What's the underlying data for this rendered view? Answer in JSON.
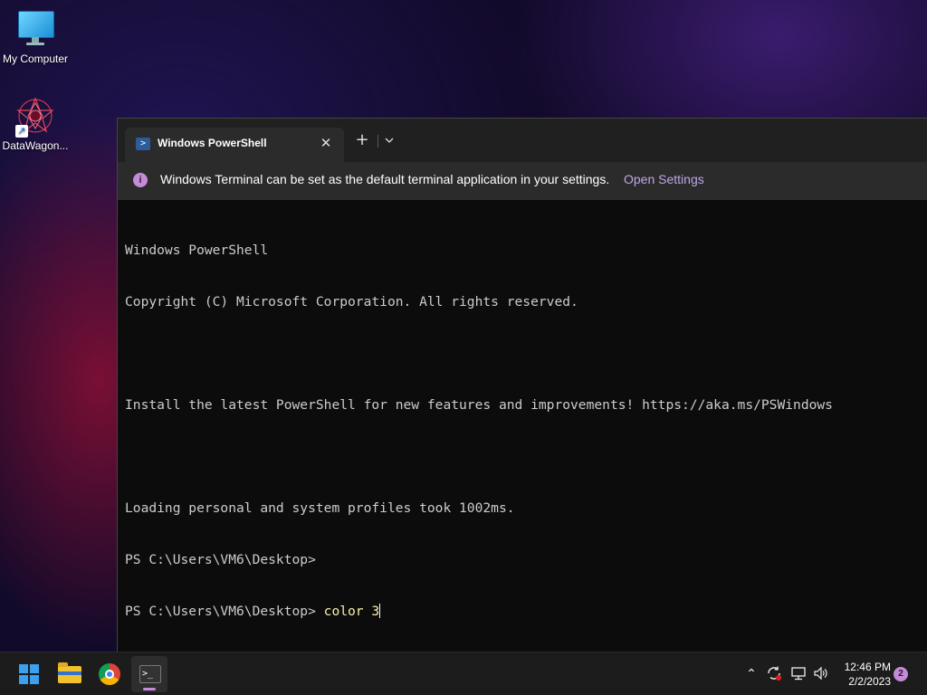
{
  "desktop": {
    "icons": [
      {
        "label": "My Computer",
        "icon": "monitor-icon"
      },
      {
        "label": "DataWagon...",
        "icon": "datawagon-icon"
      }
    ]
  },
  "terminal": {
    "tab_title": "Windows PowerShell",
    "tab_close": "✕",
    "new_tab": "+",
    "infobar": {
      "icon": "i",
      "message": "Windows Terminal can be set as the default terminal application in your settings.",
      "link": "Open Settings"
    },
    "console": {
      "lines": [
        "Windows PowerShell",
        "Copyright (C) Microsoft Corporation. All rights reserved.",
        "",
        "Install the latest PowerShell for new features and improvements! https://aka.ms/PSWindows",
        "",
        "Loading personal and system profiles took 1002ms.",
        "PS C:\\Users\\VM6\\Desktop>"
      ],
      "prompt": "PS C:\\Users\\VM6\\Desktop> ",
      "current_command": "color 3"
    }
  },
  "taskbar": {
    "apps": [
      "start-icon",
      "file-explorer-icon",
      "chrome-icon",
      "terminal-icon"
    ],
    "terminal_icon_text": ">_",
    "tray": {
      "chevron": "⌃",
      "time": "12:46 PM",
      "date": "2/2/2023",
      "notification_count": "2"
    },
    "accent": "#c58ad8"
  }
}
